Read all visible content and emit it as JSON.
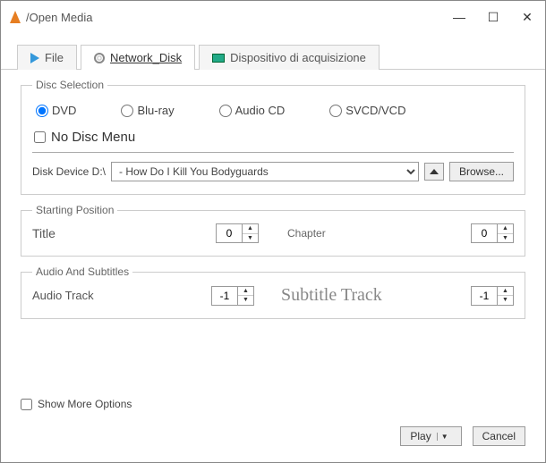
{
  "window": {
    "title": "/Open Media"
  },
  "tabs": {
    "file": "File",
    "disk": "Network_Disk",
    "device": "Dispositivo di acquisizione"
  },
  "disc": {
    "legend": "Disc Selection",
    "dvd": "DVD",
    "bluray": "Blu-ray",
    "audiocd": "Audio CD",
    "svcd": "SVCD/VCD",
    "no_menu": "No Disc Menu",
    "device_label": "Disk Device D:\\",
    "device_value": "- How Do I Kill You Bodyguards",
    "browse": "Browse..."
  },
  "position": {
    "legend": "Starting Position",
    "title_label": "Title",
    "title_value": "0",
    "chapter_label": "Chapter",
    "chapter_value": "0"
  },
  "audio": {
    "legend": "Audio And Subtitles",
    "track_label": "Audio Track",
    "track_value": "-1",
    "sub_label": "Subtitle Track",
    "sub_value": "-1"
  },
  "footer": {
    "show_more": "Show More Options",
    "play": "Play",
    "cancel": "Cancel"
  }
}
